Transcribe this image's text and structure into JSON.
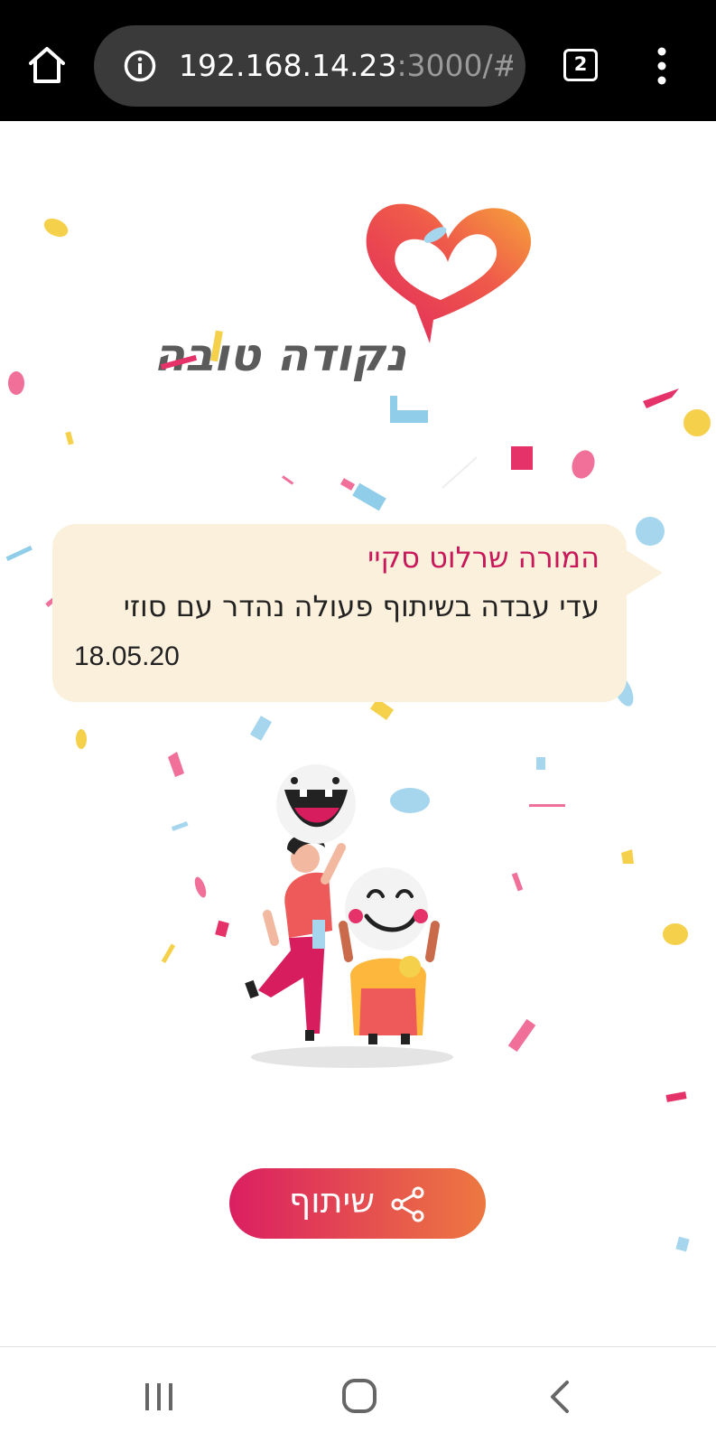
{
  "browser": {
    "url_host": "192.168.14.23",
    "url_path": ":3000/#/",
    "tab_count": "2",
    "icons": {
      "home": "home-icon",
      "info": "info-icon",
      "menu": "more-vertical-icon"
    }
  },
  "logo": {
    "text": "נקודה טובה",
    "icon": "heart-speech-bubble-icon"
  },
  "card": {
    "teacher": "המורה שרלוט סקיי",
    "message": "עדי עבדה בשיתוף פעולה נהדר עם סוזי",
    "date": "18.05.20"
  },
  "share": {
    "label": "שיתוף",
    "icon": "share-icon"
  },
  "colors": {
    "accent": "#c8185a",
    "card_bg": "#fbf0dc",
    "button_start": "#db1f62",
    "button_end": "#ed7840"
  },
  "system_nav": {
    "icons": [
      "recent-apps-icon",
      "home-circle-icon",
      "back-chevron-icon"
    ]
  }
}
